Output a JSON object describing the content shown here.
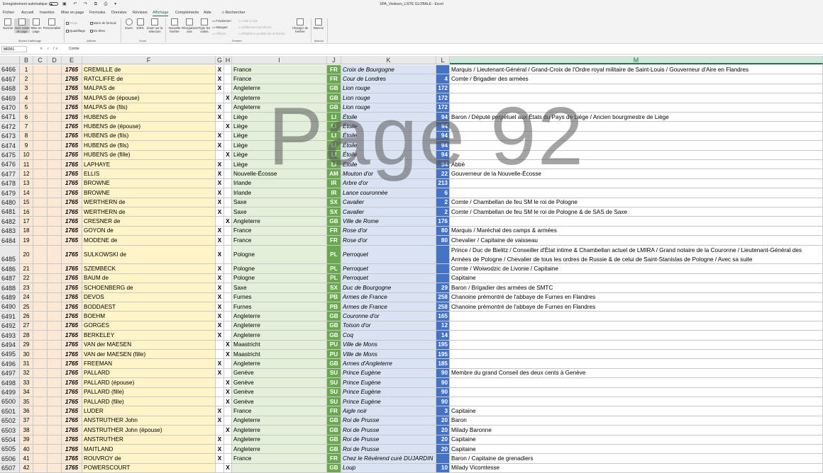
{
  "window": {
    "autosave_label": "Enregistrement automatique",
    "title": "SPA_Visiteurs_LISTE GLOBALE  -  Excel"
  },
  "tabs": [
    "Fichier",
    "Accueil",
    "Insertion",
    "Mise en page",
    "Formules",
    "Données",
    "Révision",
    "Affichage",
    "Compléments",
    "Aide",
    "Rechercher"
  ],
  "active_tab": "Affichage",
  "ribbon": {
    "normal": "Normal",
    "page_break": "Avec sauts de page",
    "page_layout": "Mise en page",
    "custom": "Personnalisé",
    "group_modes": "Modes d'affichage",
    "regle": "Règle",
    "quadrillage": "Quadrillage",
    "barre_formule": "Barre de formule",
    "en_tetes": "En-têtes",
    "group_afficher": "Afficher",
    "zoom": "Zoom",
    "zoom100": "100%",
    "zoom_sel": "Zoom sur la sélection",
    "group_zoom": "Zoom",
    "new_window": "Nouvelle fenêtre",
    "reorganize": "Réorganiser tout",
    "freeze": "Figer les volets",
    "split": "Fractionner",
    "hide": "Masquer",
    "show": "Afficher",
    "side": "Côte à côte",
    "sync": "Défilement synchrone",
    "reset": "Rétablir la position de la fenêtre",
    "change_window": "Changer de fenêtre",
    "group_fenetre": "Fenêtre",
    "macros": "Macros",
    "group_macros": "Macros"
  },
  "formula_bar": {
    "name_box": "M6551",
    "fx": "fx",
    "value": "Comte"
  },
  "columns": [
    "B",
    "C",
    "D",
    "E",
    "F",
    "G",
    "H",
    "I",
    "J",
    "K",
    "L",
    "M"
  ],
  "active_column": "M",
  "watermark": "Page 92",
  "rows": [
    {
      "rn": "6466",
      "b": "1",
      "e": "1765",
      "f": "CREMILLE de",
      "g": "X",
      "h": "",
      "i": "France",
      "j": "FR",
      "k": "Croix de Bourgogne",
      "l": "",
      "m": "Marquis / Lieutenant-Général / Grand-Croix de l'Ordre royal militaire de Saint-Louis / Gouverneur d'Aire en Flandres"
    },
    {
      "rn": "6467",
      "b": "2",
      "e": "1765",
      "f": "RATCLIFFE de",
      "g": "X",
      "h": "",
      "i": "France",
      "j": "FR",
      "k": "Cour de Londres",
      "l": "4",
      "m": "Comte / Brigadier des armées"
    },
    {
      "rn": "6468",
      "b": "3",
      "e": "1765",
      "f": "MALPAS de",
      "g": "X",
      "h": "",
      "i": "Angleterre",
      "j": "GB",
      "k": "Lion rouge",
      "l": "172",
      "m": ""
    },
    {
      "rn": "6469",
      "b": "4",
      "e": "1765",
      "f": "MALPAS de (épouse)",
      "g": "",
      "h": "X",
      "i": "Angleterre",
      "j": "GB",
      "k": "Lion rouge",
      "l": "172",
      "m": ""
    },
    {
      "rn": "6470",
      "b": "5",
      "e": "1765",
      "f": "MALPAS de (fils)",
      "g": "X",
      "h": "",
      "i": "Angleterre",
      "j": "GB",
      "k": "Lion rouge",
      "l": "172",
      "m": ""
    },
    {
      "rn": "6471",
      "b": "6",
      "e": "1765",
      "f": "HUBENS de",
      "g": "X",
      "h": "",
      "i": "Liège",
      "j": "LI",
      "k": "Étoile",
      "l": "94",
      "m": "Baron / Député perpétuel aux États du Pays de Liège / Ancien bourgmestre de Liège"
    },
    {
      "rn": "6472",
      "b": "7",
      "e": "1765",
      "f": "HUBENS de (épouse)",
      "g": "",
      "h": "X",
      "i": "Liège",
      "j": "LI",
      "k": "Étoile",
      "l": "94",
      "m": ""
    },
    {
      "rn": "6473",
      "b": "8",
      "e": "1765",
      "f": "HUBENS de (fils)",
      "g": "X",
      "h": "",
      "i": "Liège",
      "j": "LI",
      "k": "Étoile",
      "l": "94",
      "m": ""
    },
    {
      "rn": "6474",
      "b": "9",
      "e": "1765",
      "f": "HUBENS de (fils)",
      "g": "X",
      "h": "",
      "i": "Liège",
      "j": "LI",
      "k": "Étoile",
      "l": "94",
      "m": ""
    },
    {
      "rn": "6475",
      "b": "10",
      "e": "1765",
      "f": "HUBENS de (fille)",
      "g": "",
      "h": "X",
      "i": "Liège",
      "j": "LI",
      "k": "Étoile",
      "l": "94",
      "m": ""
    },
    {
      "rn": "6476",
      "b": "11",
      "e": "1765",
      "f": "LAPHAYE",
      "g": "X",
      "h": "",
      "i": "Liège",
      "j": "LI",
      "k": "Étoile",
      "l": "94",
      "m": "Abbé"
    },
    {
      "rn": "6477",
      "b": "12",
      "e": "1765",
      "f": "ELLIS",
      "g": "X",
      "h": "",
      "i": "Nouvelle-Écosse",
      "j": "AM",
      "k": "Mouton d'or",
      "l": "22",
      "m": "Gouverneur de la Nouvelle-Écosse"
    },
    {
      "rn": "6478",
      "b": "13",
      "e": "1765",
      "f": "BROWNE",
      "g": "X",
      "h": "",
      "i": "Irlande",
      "j": "IR",
      "k": "Arbre d'or",
      "l": "213",
      "m": ""
    },
    {
      "rn": "6479",
      "b": "14",
      "e": "1765",
      "f": "BROWNE",
      "g": "X",
      "h": "",
      "i": "Irlande",
      "j": "IR",
      "k": "Lance couronnée",
      "l": "6",
      "m": ""
    },
    {
      "rn": "6480",
      "b": "15",
      "e": "1765",
      "f": "WERTHERN de",
      "g": "X",
      "h": "",
      "i": "Saxe",
      "j": "SX",
      "k": "Cavalier",
      "l": "2",
      "m": "Comte / Chambellan de feu SM le roi de Pologne"
    },
    {
      "rn": "6481",
      "b": "16",
      "e": "1765",
      "f": "WERTHERN de",
      "g": "X",
      "h": "",
      "i": "Saxe",
      "j": "SX",
      "k": "Cavalier",
      "l": "2",
      "m": "Comte / Chambellan de feu SM le roi de Pologne & de SAS de Saxe"
    },
    {
      "rn": "6482",
      "b": "17",
      "e": "1765",
      "f": "CRESNER de",
      "g": "",
      "h": "X",
      "i": "Angleterre",
      "j": "GB",
      "k": "Ville de Rome",
      "l": "176",
      "m": ""
    },
    {
      "rn": "6483",
      "b": "18",
      "e": "1765",
      "f": "GOYON de",
      "g": "X",
      "h": "",
      "i": "France",
      "j": "FR",
      "k": "Rose d'or",
      "l": "80",
      "m": "Marquis / Maréchal des camps & armées"
    },
    {
      "rn": "6484",
      "b": "19",
      "e": "1765",
      "f": "MODENE de",
      "g": "X",
      "h": "",
      "i": "France",
      "j": "FR",
      "k": "Rose d'or",
      "l": "80",
      "m": "Chevalier / Capitaine de vaisseau"
    },
    {
      "rn": "6485",
      "b": "20",
      "e": "1765",
      "f": "SULKOWSKI de",
      "g": "X",
      "h": "",
      "i": "Pologne",
      "j": "PL",
      "k": "Perroquet",
      "l": "",
      "m": "Prince / Duc de Bielitz / Conseiller d'État intime & Chambellan actuel de LMIRA / Grand notaire de la Couronne / Lieutenant-Général des Armées de Pologne / Chevalier de tous les ordres de Russie & de celui de Saint-Stanislas de Pologne / Avec sa suite",
      "tall": true
    },
    {
      "rn": "6486",
      "b": "21",
      "e": "1765",
      "f": "SZEMBECK",
      "g": "X",
      "h": "",
      "i": "Pologne",
      "j": "PL",
      "k": "Perroquet",
      "l": "",
      "m": "Comte / Woiwodzic de Livonie / Capitaine"
    },
    {
      "rn": "6487",
      "b": "22",
      "e": "1765",
      "f": "BAUM de",
      "g": "X",
      "h": "",
      "i": "Pologne",
      "j": "PL",
      "k": "Perroquet",
      "l": "",
      "m": "Capitaine"
    },
    {
      "rn": "6488",
      "b": "23",
      "e": "1765",
      "f": "SCHOENBERG de",
      "g": "X",
      "h": "",
      "i": "Saxe",
      "j": "SX",
      "k": "Duc de Bourgogne",
      "l": "29",
      "m": "Baron / Brigadier des armées de SMTC"
    },
    {
      "rn": "6489",
      "b": "24",
      "e": "1765",
      "f": "DEVOS",
      "g": "X",
      "h": "",
      "i": "Furnes",
      "j": "PB",
      "k": "Armes de France",
      "l": "258",
      "m": "Chanoine prémontré de l'abbaye de Furnes en Flandres"
    },
    {
      "rn": "6490",
      "b": "25",
      "e": "1765",
      "f": "BODDAEST",
      "g": "X",
      "h": "",
      "i": "Furnes",
      "j": "PB",
      "k": "Armes de France",
      "l": "258",
      "m": "Chanoine prémontré de l'abbaye de Furnes en Flandres"
    },
    {
      "rn": "6491",
      "b": "26",
      "e": "1765",
      "f": "BOEHM",
      "g": "X",
      "h": "",
      "i": "Angleterre",
      "j": "GB",
      "k": "Couronne d'or",
      "l": "165",
      "m": ""
    },
    {
      "rn": "6492",
      "b": "27",
      "e": "1765",
      "f": "GORGES",
      "g": "X",
      "h": "",
      "i": "Angleterre",
      "j": "GB",
      "k": "Toison d'or",
      "l": "12",
      "m": ""
    },
    {
      "rn": "6493",
      "b": "28",
      "e": "1765",
      "f": "BERKELEY",
      "g": "X",
      "h": "",
      "i": "Angleterre",
      "j": "GB",
      "k": "Coq",
      "l": "14",
      "m": ""
    },
    {
      "rn": "6494",
      "b": "29",
      "e": "1765",
      "f": "VAN der MAESEN",
      "g": "",
      "h": "X",
      "i": "Maastricht",
      "j": "PU",
      "k": "Ville de Mons",
      "l": "195",
      "m": ""
    },
    {
      "rn": "6495",
      "b": "30",
      "e": "1765",
      "f": "VAN der MAESEN (fille)",
      "g": "",
      "h": "X",
      "i": "Maastricht",
      "j": "PU",
      "k": "Ville de Mons",
      "l": "195",
      "m": ""
    },
    {
      "rn": "6496",
      "b": "31",
      "e": "1765",
      "f": "FREEMAN",
      "g": "X",
      "h": "",
      "i": "Angleterre",
      "j": "GB",
      "k": "Armes d'Angleterre",
      "l": "185",
      "m": ""
    },
    {
      "rn": "6497",
      "b": "32",
      "e": "1765",
      "f": "PALLARD",
      "g": "X",
      "h": "",
      "i": "Genève",
      "j": "SU",
      "k": "Prince Eugène",
      "l": "90",
      "m": "Membre du grand Conseil des deux cents à Genève"
    },
    {
      "rn": "6498",
      "b": "33",
      "e": "1765",
      "f": "PALLARD (épouse)",
      "g": "",
      "h": "X",
      "i": "Genève",
      "j": "SU",
      "k": "Prince Eugène",
      "l": "90",
      "m": ""
    },
    {
      "rn": "6499",
      "b": "34",
      "e": "1765",
      "f": "PALLARD (fille)",
      "g": "",
      "h": "X",
      "i": "Genève",
      "j": "SU",
      "k": "Prince Eugène",
      "l": "90",
      "m": ""
    },
    {
      "rn": "6500",
      "b": "35",
      "e": "1765",
      "f": "PALLARD (fille)",
      "g": "",
      "h": "X",
      "i": "Genève",
      "j": "SU",
      "k": "Prince Eugène",
      "l": "90",
      "m": ""
    },
    {
      "rn": "6501",
      "b": "36",
      "e": "1765",
      "f": "LUDER",
      "g": "X",
      "h": "",
      "i": "France",
      "j": "FR",
      "k": "Aigle noir",
      "l": "3",
      "m": "Capitaine"
    },
    {
      "rn": "6502",
      "b": "37",
      "e": "1765",
      "f": "ANSTRUTHER John",
      "g": "X",
      "h": "",
      "i": "Angleterre",
      "j": "GB",
      "k": "Roi de Prusse",
      "l": "20",
      "m": "Baron"
    },
    {
      "rn": "6503",
      "b": "38",
      "e": "1765",
      "f": "ANSTRUTHER John (épouse)",
      "g": "",
      "h": "X",
      "i": "Angleterre",
      "j": "GB",
      "k": "Roi de Prusse",
      "l": "20",
      "m": "Milady Baronne"
    },
    {
      "rn": "6504",
      "b": "39",
      "e": "1765",
      "f": "ANSTRUTHER",
      "g": "X",
      "h": "",
      "i": "Angleterre",
      "j": "GB",
      "k": "Roi de Prusse",
      "l": "20",
      "m": "Capitaine"
    },
    {
      "rn": "6505",
      "b": "40",
      "e": "1765",
      "f": "MAITLAND",
      "g": "X",
      "h": "",
      "i": "Angleterre",
      "j": "GB",
      "k": "Roi de Prusse",
      "l": "20",
      "m": "Capitaine"
    },
    {
      "rn": "6506",
      "b": "41",
      "e": "1765",
      "f": "ROUVROY de",
      "g": "X",
      "h": "",
      "i": "France",
      "j": "FR",
      "k": "Chez le Révérend curé DUJARDIN",
      "l": "",
      "m": "Baron / Capitaine de grenadiers"
    },
    {
      "rn": "6507",
      "b": "42",
      "e": "1765",
      "f": "POWERSCOURT",
      "g": "",
      "h": "X",
      "i": "",
      "j": "GB",
      "k": "Loup",
      "l": "10",
      "m": "Milady Vicomtesse"
    }
  ]
}
